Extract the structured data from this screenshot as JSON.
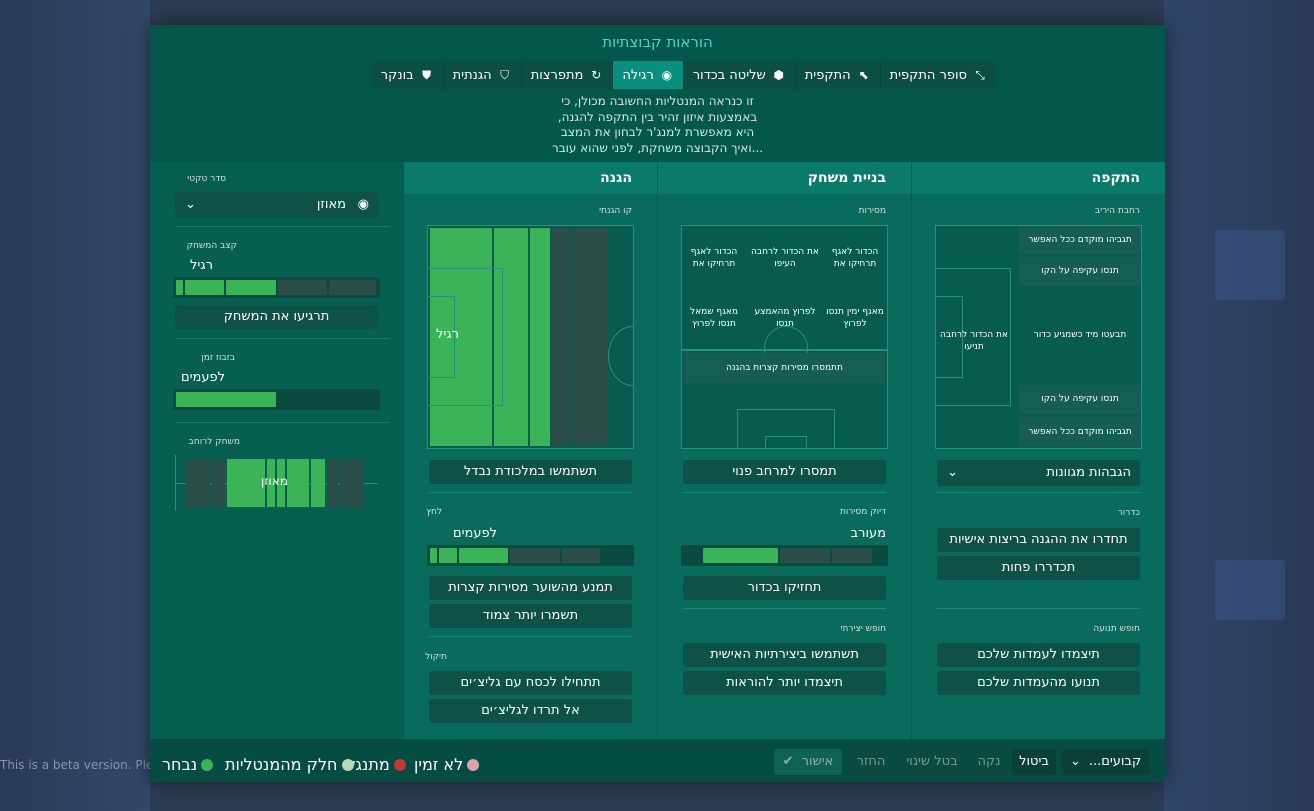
{
  "title": "הוראות קבוצתיות",
  "styles": [
    {
      "label": "סופר התקפית",
      "icon": "super-attack-icon"
    },
    {
      "label": "התקפית",
      "icon": "attack-icon"
    },
    {
      "label": "שליטה בכדור",
      "icon": "possession-icon"
    },
    {
      "label": "רגילה",
      "icon": "balanced-icon",
      "active": true
    },
    {
      "label": "מתפרצות",
      "icon": "counter-icon"
    },
    {
      "label": "הגנתית",
      "icon": "defensive-icon"
    },
    {
      "label": "בונקר",
      "icon": "bunker-icon"
    }
  ],
  "description": [
    "זו כנראה המנטליות החשובה מכולן, כי",
    "באמצעות איזון זהיר בין התקפה להגנה,",
    "היא מאפשרת למנג'ר לבחון את המצב",
    "...ואיך הקבוצה משחקת, לפני שהוא עובר"
  ],
  "attack": {
    "heading": "התקפה",
    "width_label": "רחבת היריב",
    "cells": {
      "top1": "תגביהו מוקדם ככל האפשר",
      "top2": "תנסו עקיפה על הקו",
      "mid": "תבעטו מיד כשמגיע כדור",
      "box": "את הכדור לרחבה תניעו",
      "bot1": "תנסו עקיפה על הקו",
      "bot2": "תגביהו מוקדם ככל האפשר"
    },
    "cross_select": "הגבהות מגוונות",
    "dribble_label": "כדרור",
    "dribble_btn1": "תחדרו את ההגנה בריצות אישיות",
    "dribble_btn2": "תכדררו פחות",
    "movement_label": "חופש תנועה",
    "move_btn1": "תיצמדו לעמדות שלכם",
    "move_btn2": "תנועו מהעמדות שלכם"
  },
  "buildup": {
    "heading": "בניית משחק",
    "passing_label": "מסירות",
    "cells": {
      "r1": "הכדור לאגף תרחיקו את",
      "c1": "את הכדור לרחבה העיפו",
      "l1": "הכדור לאגף תרחיקו את",
      "r2": "מאגף ימין תנסו לפרוץ",
      "c2": "לפרוץ מהאמצע תנסו",
      "l2": "מאגף שמאל תנסו לפרוץ",
      "wide": "תתמסרו מסירות קצרות בהגנה"
    },
    "space_btn": "תמסרו למרחב פנוי",
    "accuracy_label": "דיוק מסירות",
    "accuracy_value": "מעורב",
    "accuracy_level": 0.5,
    "possession_btn": "תחזיקו בכדור",
    "creative_label": "חופש יצירתי",
    "creative_btn1": "תשתמשו ביצירתיות האישית",
    "creative_btn2": "תיצמדו יותר להוראות"
  },
  "defense": {
    "heading": "הגנה",
    "line_label": "קו הגנתי",
    "line_value": "רגיל",
    "line_level": 0.6,
    "offside_btn": "תשתמשו במלכודת נבדל",
    "press_label": "לחץ",
    "press_value": "לפעמים",
    "press_level": 0.4,
    "press_btn1": "תמנע מהשוער מסירות קצרות",
    "press_btn2": "תשמרו יותר צמוד",
    "tackle_label": "תיקול",
    "tackle_btn1": "תתחילו לכסח עם גליצ׳ים",
    "tackle_btn2": "אל תרדו לגליצ׳ים"
  },
  "side": {
    "order_label": "סדר טקטי",
    "order_value": "מאוזן",
    "tempo_label": "קצב המשחק",
    "tempo_value": "רגיל",
    "tempo_level": 0.5,
    "tempo_btn": "תרגיעו את המשחק",
    "timewaste_label": "בזבוז זמן",
    "timewaste_value": "לפעמים",
    "timewaste_level": 0.5,
    "width_label": "משחק לרוחב",
    "width_value": "מאוזן",
    "width_level": 0.5
  },
  "footer": {
    "presets": "קבועים...",
    "cancel": "ביטול",
    "clear": "נקה",
    "undo": "בטל שינוי",
    "back": "החזר",
    "confirm": "אישור",
    "legend": [
      {
        "label": "לא זמין",
        "color": "#d9a3a8"
      },
      {
        "label": "מתנגש",
        "color": "#c0393b"
      },
      {
        "label": "חלק מהמנטליות",
        "color": "#b9d7b0"
      },
      {
        "label": "נבחר",
        "color": "#3bb357"
      }
    ]
  },
  "beta_notice": "This is a beta version. Please report any issues at https://community.sigames.com"
}
